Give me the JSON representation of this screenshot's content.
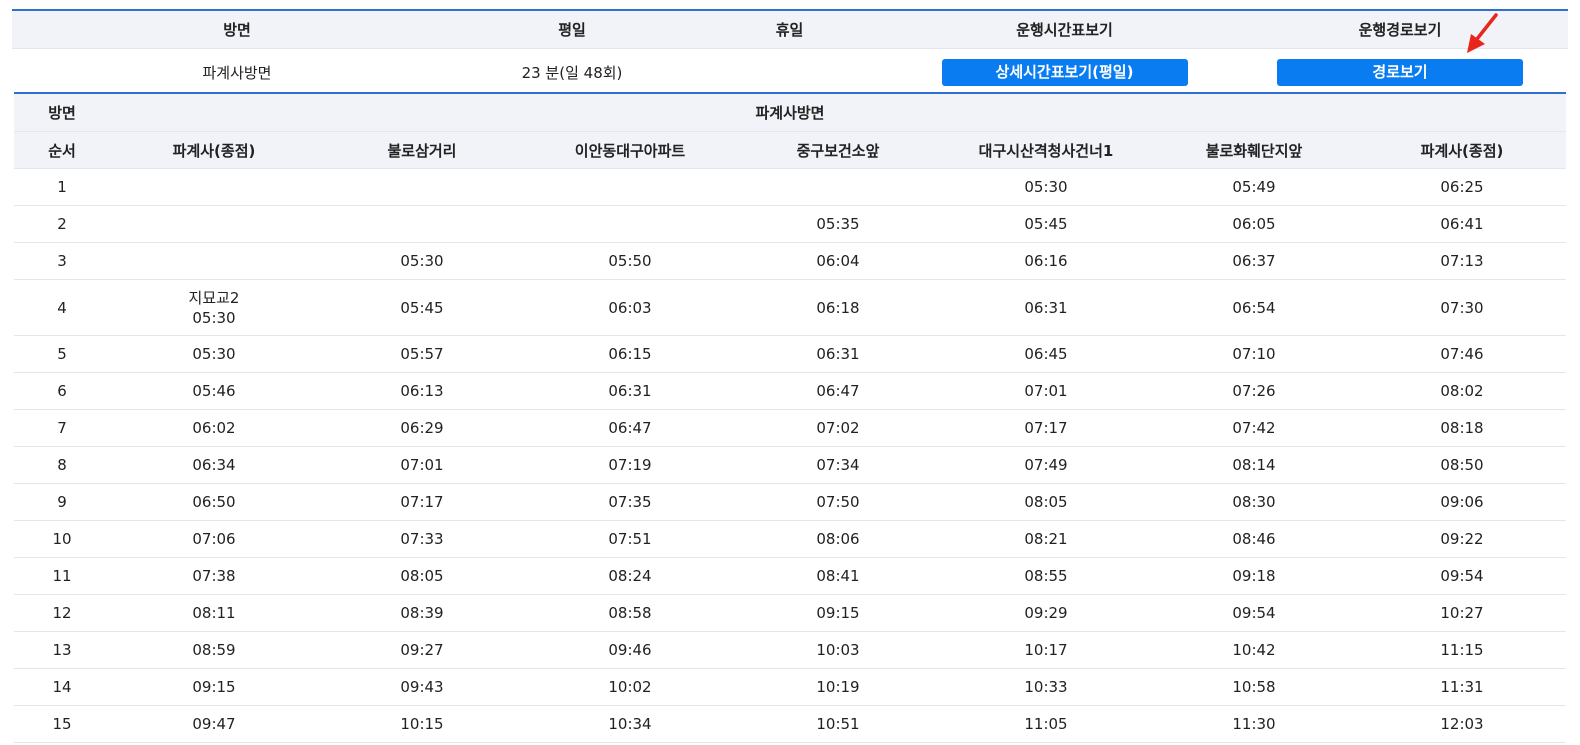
{
  "summary": {
    "headers": [
      "방면",
      "평일",
      "휴일",
      "운행시간표보기",
      "운행경로보기"
    ],
    "direction": "파계사방면",
    "weekday": "23 분(일 48회)",
    "holiday": "",
    "detail_button": "상세시간표보기(평일)",
    "route_button": "경로보기"
  },
  "annotation": {
    "color": "#e8261c",
    "icon": "red-arrow-icon"
  },
  "timetable": {
    "direction_label": "방면",
    "direction_value": "파계사방면",
    "order_label": "순서",
    "stops": [
      "파계사(종점)",
      "불로삼거리",
      "이안동대구아파트",
      "중구보건소앞",
      "대구시산격청사건너1",
      "불로화훼단지앞",
      "파계사(종점)"
    ],
    "rows": [
      {
        "n": "1",
        "t": [
          "",
          "",
          "",
          "",
          "05:30",
          "05:49",
          "06:25"
        ]
      },
      {
        "n": "2",
        "t": [
          "",
          "",
          "",
          "05:35",
          "05:45",
          "06:05",
          "06:41"
        ]
      },
      {
        "n": "3",
        "t": [
          "",
          "05:30",
          "05:50",
          "06:04",
          "06:16",
          "06:37",
          "07:13"
        ]
      },
      {
        "n": "4",
        "t": [
          "지묘교2",
          "05:45",
          "06:03",
          "06:18",
          "06:31",
          "06:54",
          "07:30"
        ],
        "t0b": "05:30"
      },
      {
        "n": "5",
        "t": [
          "05:30",
          "05:57",
          "06:15",
          "06:31",
          "06:45",
          "07:10",
          "07:46"
        ]
      },
      {
        "n": "6",
        "t": [
          "05:46",
          "06:13",
          "06:31",
          "06:47",
          "07:01",
          "07:26",
          "08:02"
        ]
      },
      {
        "n": "7",
        "t": [
          "06:02",
          "06:29",
          "06:47",
          "07:02",
          "07:17",
          "07:42",
          "08:18"
        ]
      },
      {
        "n": "8",
        "t": [
          "06:34",
          "07:01",
          "07:19",
          "07:34",
          "07:49",
          "08:14",
          "08:50"
        ]
      },
      {
        "n": "9",
        "t": [
          "06:50",
          "07:17",
          "07:35",
          "07:50",
          "08:05",
          "08:30",
          "09:06"
        ]
      },
      {
        "n": "10",
        "t": [
          "07:06",
          "07:33",
          "07:51",
          "08:06",
          "08:21",
          "08:46",
          "09:22"
        ]
      },
      {
        "n": "11",
        "t": [
          "07:38",
          "08:05",
          "08:24",
          "08:41",
          "08:55",
          "09:18",
          "09:54"
        ]
      },
      {
        "n": "12",
        "t": [
          "08:11",
          "08:39",
          "08:58",
          "09:15",
          "09:29",
          "09:54",
          "10:27"
        ]
      },
      {
        "n": "13",
        "t": [
          "08:59",
          "09:27",
          "09:46",
          "10:03",
          "10:17",
          "10:42",
          "11:15"
        ]
      },
      {
        "n": "14",
        "t": [
          "09:15",
          "09:43",
          "10:02",
          "10:19",
          "10:33",
          "10:58",
          "11:31"
        ]
      },
      {
        "n": "15",
        "t": [
          "09:47",
          "10:15",
          "10:34",
          "10:51",
          "11:05",
          "11:30",
          "12:03"
        ]
      }
    ]
  }
}
